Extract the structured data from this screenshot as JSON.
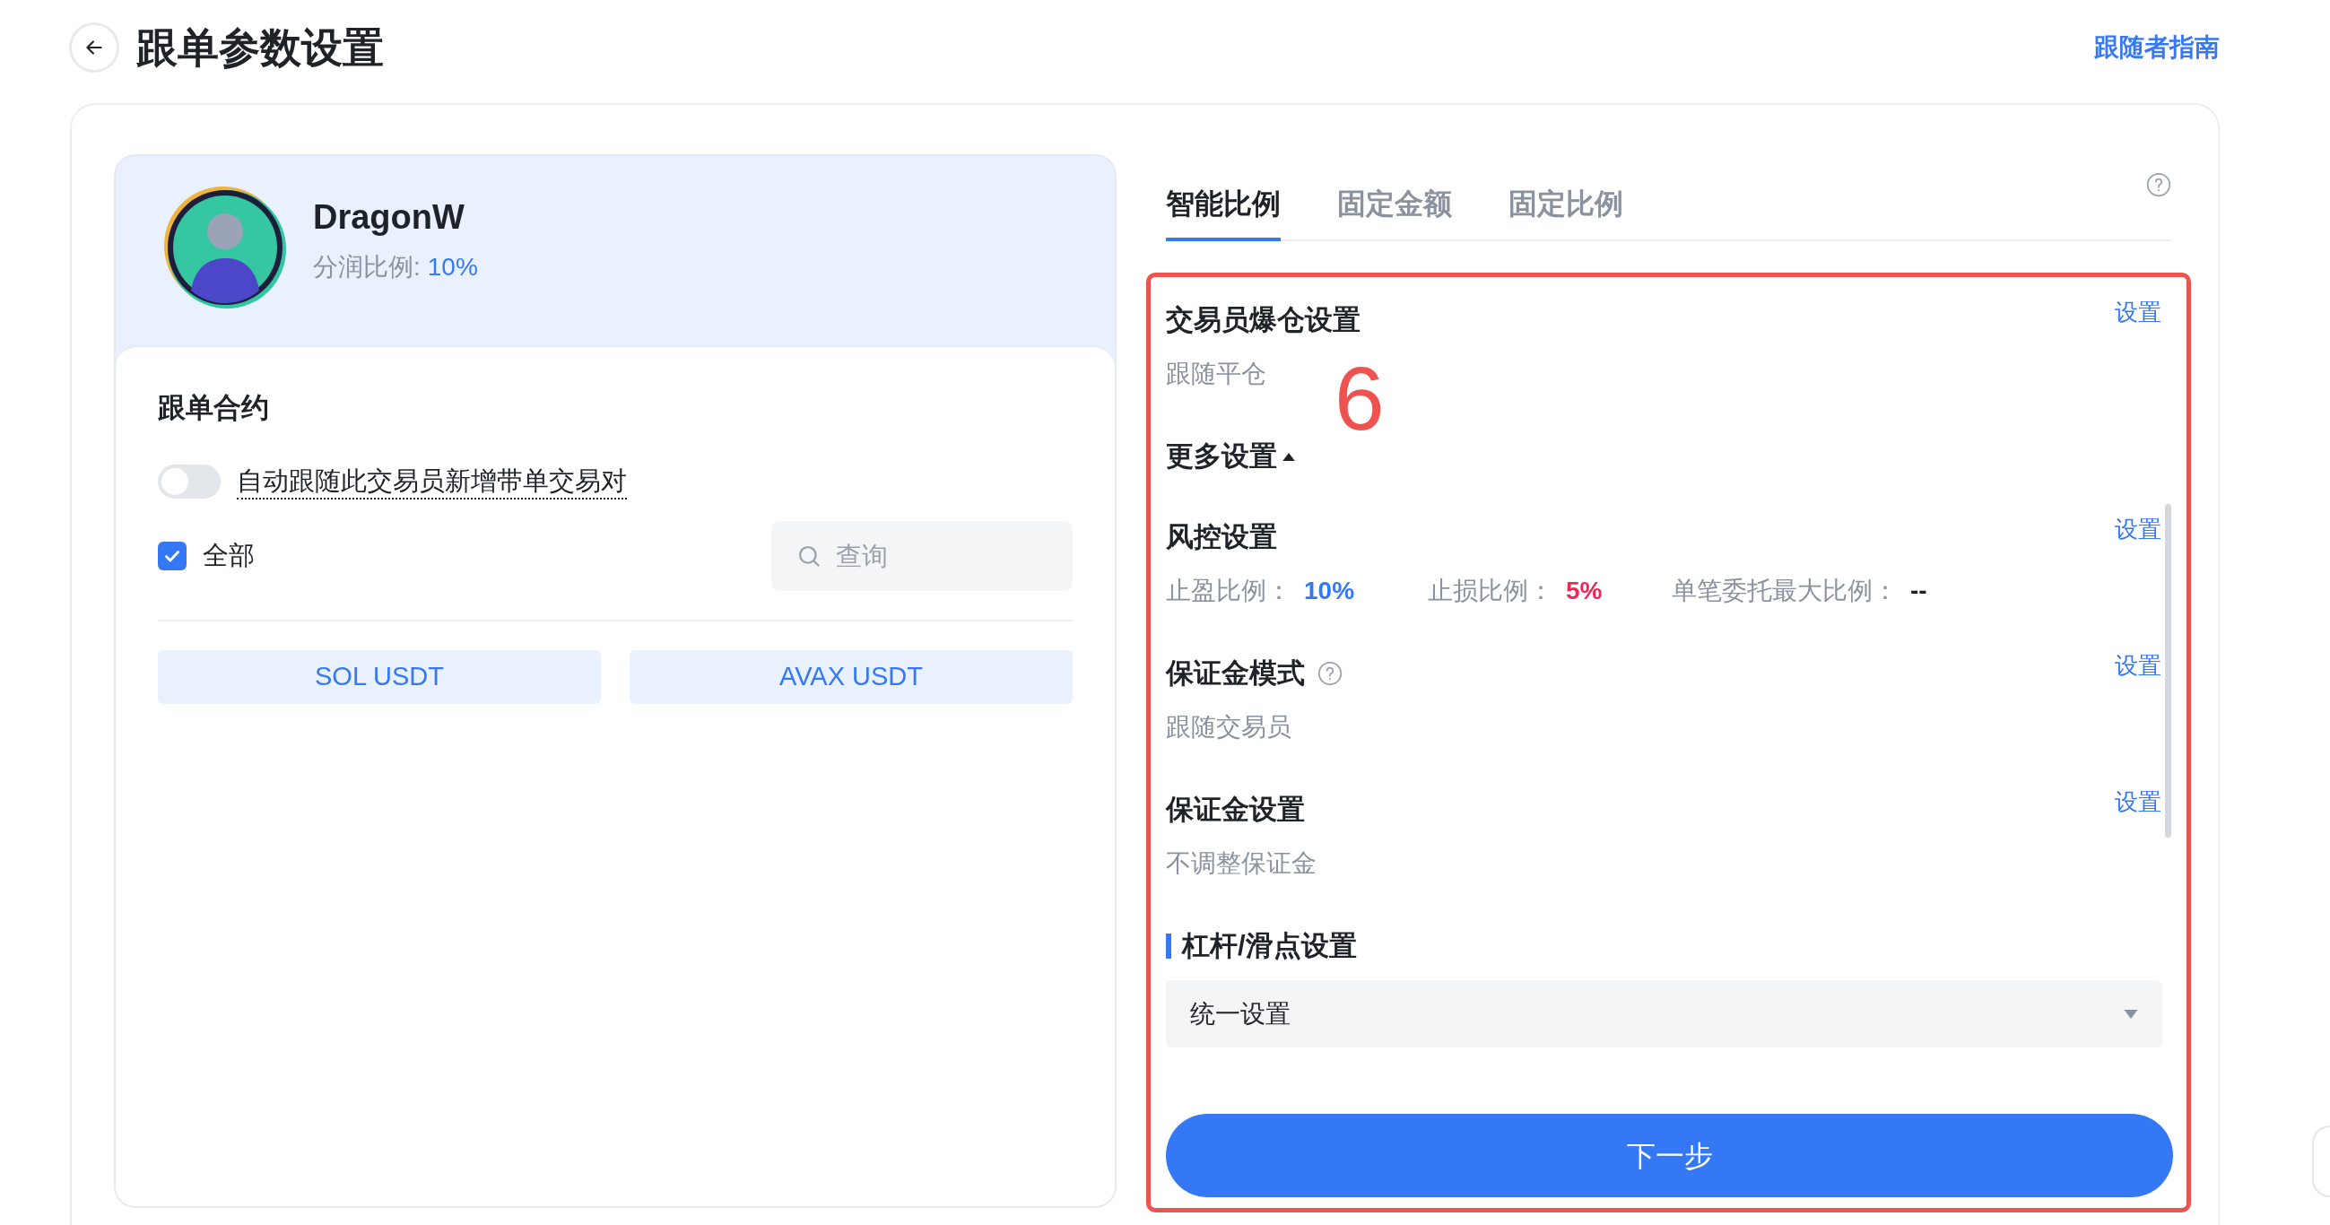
{
  "header": {
    "title": "跟单参数设置",
    "guide_link": "跟随者指南"
  },
  "trader": {
    "name": "DragonW",
    "share_label": "分润比例:",
    "share_value": "10%"
  },
  "contracts": {
    "title": "跟单合约",
    "auto_follow": {
      "label": "自动跟随此交易员新增带单交易对",
      "on": false
    },
    "select_all": {
      "label": "全部",
      "checked": true
    },
    "search": {
      "placeholder": "查询"
    },
    "pairs": [
      "SOL USDT",
      "AVAX USDT"
    ]
  },
  "tabs": [
    {
      "label": "智能比例",
      "selected": true
    },
    {
      "label": "固定金额",
      "selected": false
    },
    {
      "label": "固定比例",
      "selected": false
    }
  ],
  "sections": [
    {
      "kind": "setting",
      "title": "交易员爆仓设置",
      "action": "设置",
      "value": "跟随平仓"
    },
    {
      "kind": "toggle",
      "title": "更多设置",
      "expanded": true
    },
    {
      "kind": "risk",
      "title": "风控设置",
      "action": "设置",
      "fields": [
        {
          "label": "止盈比例：",
          "value": "10%",
          "color": "#3478f6"
        },
        {
          "label": "止损比例：",
          "value": "5%",
          "color": "#f0265a"
        },
        {
          "label": "单笔委托最大比例：",
          "value": "--",
          "color": "#1f2329"
        }
      ]
    },
    {
      "kind": "setting",
      "title": "保证金模式",
      "help": true,
      "action": "设置",
      "value": "跟随交易员"
    },
    {
      "kind": "setting",
      "title": "保证金设置",
      "action": "设置",
      "value": "不调整保证金"
    },
    {
      "kind": "select",
      "title": "杠杆/滑点设置",
      "value": "统一设置"
    }
  ],
  "next_button": "下一步",
  "annotation": {
    "label": "6"
  }
}
